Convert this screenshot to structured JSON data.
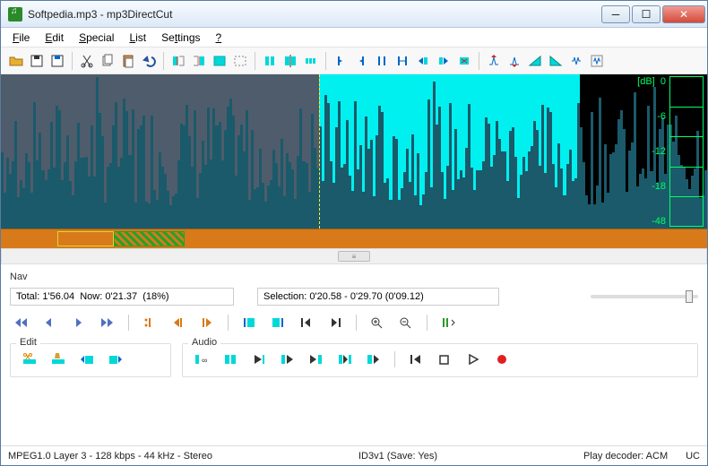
{
  "window": {
    "title": "Softpedia.mp3 - mp3DirectCut"
  },
  "menu": {
    "file": "File",
    "edit": "Edit",
    "special": "Special",
    "list": "List",
    "settings": "Settings",
    "help": "?"
  },
  "toolbar": {
    "open": "open",
    "save": "save",
    "save_sel": "save-selection",
    "cut": "cut",
    "copy": "copy",
    "paste": "paste",
    "undo": "undo",
    "set_begin": "set-begin",
    "set_end": "set-end",
    "sel_all": "select-all",
    "sel_none": "select-none",
    "cue": "cue",
    "split": "split",
    "auto_cue": "auto-cue",
    "fade_in": "fade-in",
    "fade_out": "fade-out",
    "gain": "gain",
    "norm": "normalize",
    "trim": "trim",
    "crop": "crop",
    "zoom_in": "zoom-in",
    "zoom_out": "zoom-out",
    "zoom_sel": "zoom-sel",
    "zoom_full": "zoom-full"
  },
  "db": {
    "label": "[dB]",
    "t0": "0",
    "t6": "-6",
    "t12": "-12",
    "t18": "-18",
    "t48": "-48"
  },
  "nav": {
    "title": "Nav",
    "total_label": "Total:",
    "total_val": "1'56.04",
    "now_label": "Now:",
    "now_val": "0'21.37",
    "pct": "(18%)",
    "sel_label": "Selection:",
    "sel_val": "0'20.58 - 0'29.70 (0'09.12)"
  },
  "edit": {
    "title": "Edit"
  },
  "audio": {
    "title": "Audio"
  },
  "status": {
    "format": "MPEG1.0 Layer 3 - 128 kbps - 44 kHz - Stereo",
    "id3": "ID3v1 (Save: Yes)",
    "decoder": "Play decoder: ACM",
    "uc": "UC"
  },
  "colors": {
    "accent": "#00e8e8",
    "wave": "#1a5a6a",
    "timeline": "#d87a1a"
  }
}
